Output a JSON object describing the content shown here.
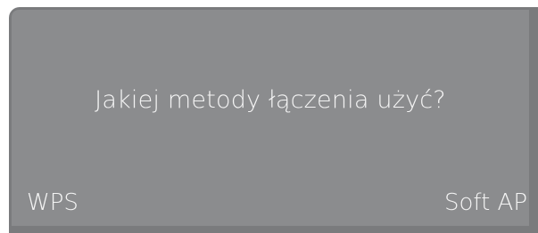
{
  "dialog": {
    "question": "Jakiej metody łączenia użyć?",
    "options": [
      {
        "label": "WPS"
      },
      {
        "label": "Soft AP"
      }
    ]
  },
  "colors": {
    "frame": "#7a7b7d",
    "screen": "#8b8c8e",
    "text": "#f4f4f4"
  }
}
